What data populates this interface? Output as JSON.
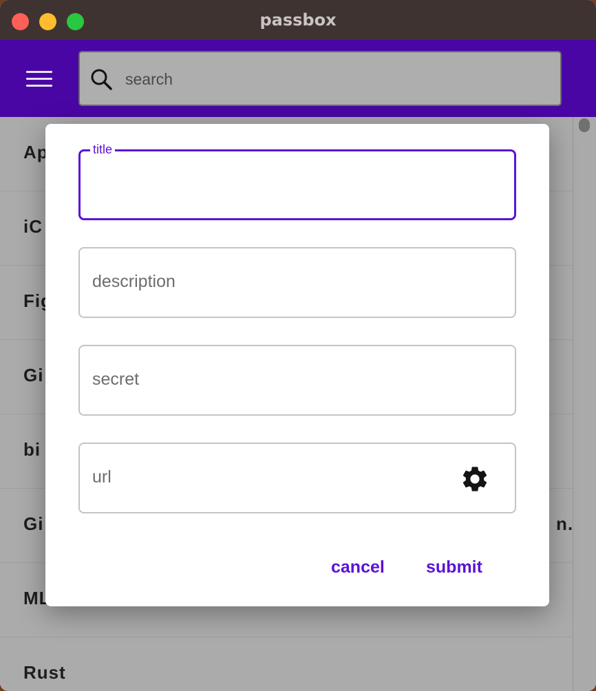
{
  "window": {
    "title": "passbox"
  },
  "search": {
    "placeholder": "search"
  },
  "list": {
    "items": [
      {
        "label": "Ap"
      },
      {
        "label": "iC"
      },
      {
        "label": "Fig"
      },
      {
        "label": "Gi"
      },
      {
        "label": "bi"
      },
      {
        "label": "Gi"
      },
      {
        "label": "ML"
      },
      {
        "label": "Rust"
      }
    ],
    "truncated_suffix": "n…"
  },
  "dialog": {
    "title_label": "title",
    "title_value": "",
    "description_placeholder": "description",
    "secret_placeholder": "secret",
    "url_placeholder": "url",
    "cancel_label": "cancel",
    "submit_label": "submit"
  },
  "icons": {
    "menu": "menu-icon",
    "search": "search-icon",
    "gear": "gear-icon"
  },
  "colors": {
    "accent": "#5b12d6",
    "appbar": "#4a06a5",
    "titlebar": "#3f3331"
  }
}
